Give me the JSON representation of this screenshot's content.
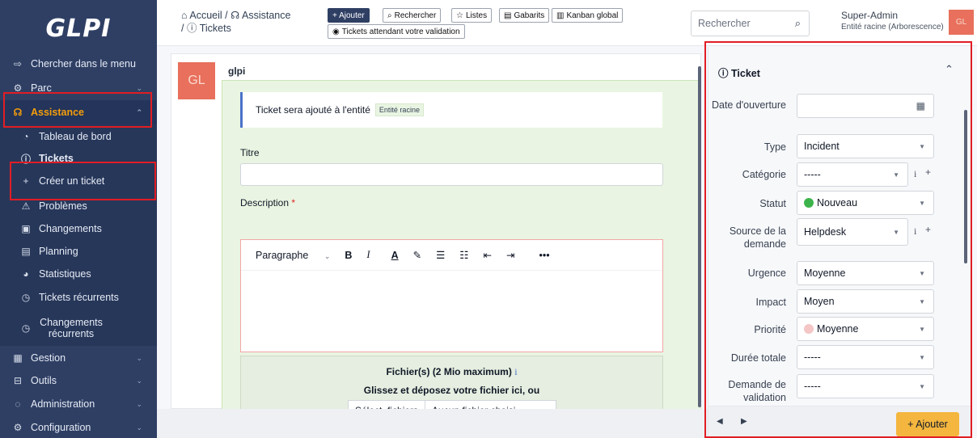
{
  "app": {
    "logo": "GLPI"
  },
  "sidebar": {
    "items": [
      {
        "icon": "arrow-right-icon",
        "glyph": "⇨",
        "label": "Chercher dans le menu"
      },
      {
        "icon": "box-icon",
        "glyph": "⚙",
        "label": "Parc"
      },
      {
        "icon": "headset-icon",
        "glyph": "☊",
        "label": "Assistance"
      },
      {
        "icon": "dashboard-icon",
        "glyph": "◔",
        "label": "Tableau de bord"
      },
      {
        "icon": "alert-circle-icon",
        "glyph": "ⓘ",
        "label": "Tickets"
      },
      {
        "icon": "plus-icon",
        "glyph": "+",
        "label": "Créer un ticket"
      },
      {
        "icon": "warning-icon",
        "glyph": "⚠",
        "label": "Problèmes"
      },
      {
        "icon": "clipboard-icon",
        "glyph": "▣",
        "label": "Changements"
      },
      {
        "icon": "calendar-icon",
        "glyph": "▤",
        "label": "Planning"
      },
      {
        "icon": "chart-pie-icon",
        "glyph": "◕",
        "label": "Statistiques"
      },
      {
        "icon": "alarm-icon",
        "glyph": "◷",
        "label": "Tickets récurrents"
      },
      {
        "icon": "alarm-icon",
        "glyph": "◷",
        "label": "Changements récurrents"
      },
      {
        "icon": "wallet-icon",
        "glyph": "▦",
        "label": "Gestion"
      },
      {
        "icon": "briefcase-icon",
        "glyph": "⊟",
        "label": "Outils"
      },
      {
        "icon": "shield-icon",
        "glyph": "◌",
        "label": "Administration"
      },
      {
        "icon": "settings-icon",
        "glyph": "⚙",
        "label": "Configuration"
      }
    ]
  },
  "header": {
    "crumb_home": "Accueil",
    "crumb_sep": "/",
    "crumb_assist": "Assistance",
    "crumb_tickets": "Tickets",
    "btn_add": "+ Ajouter",
    "btn_search": "Rechercher",
    "btn_lists": "Listes",
    "btn_templates": "Gabarits",
    "btn_kanban": "Kanban global",
    "btn_waiting": "Tickets attendant votre validation",
    "search_placeholder": "Rechercher",
    "user_name": "Super-Admin",
    "user_entity": "Entité racine (Arborescence)",
    "user_initials": "GL"
  },
  "main": {
    "avatar": "GL",
    "author": "glpi",
    "info_text": "Ticket sera ajouté à l'entité",
    "info_entity": "Entité racine",
    "title_label": "Titre",
    "title_value": "",
    "desc_label": "Description",
    "required_mark": "*",
    "editor_paragraph": "Paragraphe",
    "editor_bold": "B",
    "editor_italic": "I",
    "editor_color": "A",
    "editor_highlight": "✎",
    "editor_bullets": "☰",
    "editor_numbers": "☷",
    "editor_outdent": "⇤",
    "editor_indent": "⇥",
    "editor_more": "•••",
    "files_title": "Fichier(s) (2 Mio maximum)",
    "files_drop": "Glissez et déposez votre fichier ici, ou",
    "files_button": "Sélect. fichiers",
    "files_none": "Aucun fichier choisi"
  },
  "panel": {
    "title": "Ticket",
    "fields": [
      {
        "label": "Date d'ouverture",
        "value": ""
      },
      {
        "label": "Type",
        "value": "Incident"
      },
      {
        "label": "Catégorie",
        "value": "-----"
      },
      {
        "label": "Statut",
        "value": "Nouveau",
        "dot_color": "#3cb44b"
      },
      {
        "label": "Source de la demande",
        "value": "Helpdesk"
      },
      {
        "label": "Urgence",
        "value": "Moyenne"
      },
      {
        "label": "Impact",
        "value": "Moyen"
      },
      {
        "label": "Priorité",
        "value": "Moyenne",
        "dot_color": "#f5c6c6"
      },
      {
        "label": "Durée totale",
        "value": "-----"
      },
      {
        "label": "Demande de validation",
        "value": "-----"
      }
    ],
    "add_button": "+ Ajouter"
  },
  "colors": {
    "sidebar_bg": "#2f3f64",
    "accent_orange": "#f59e0b",
    "highlight_red": "#e11d24",
    "form_green": "#e9f5e2",
    "add_button": "#f4b63e"
  }
}
